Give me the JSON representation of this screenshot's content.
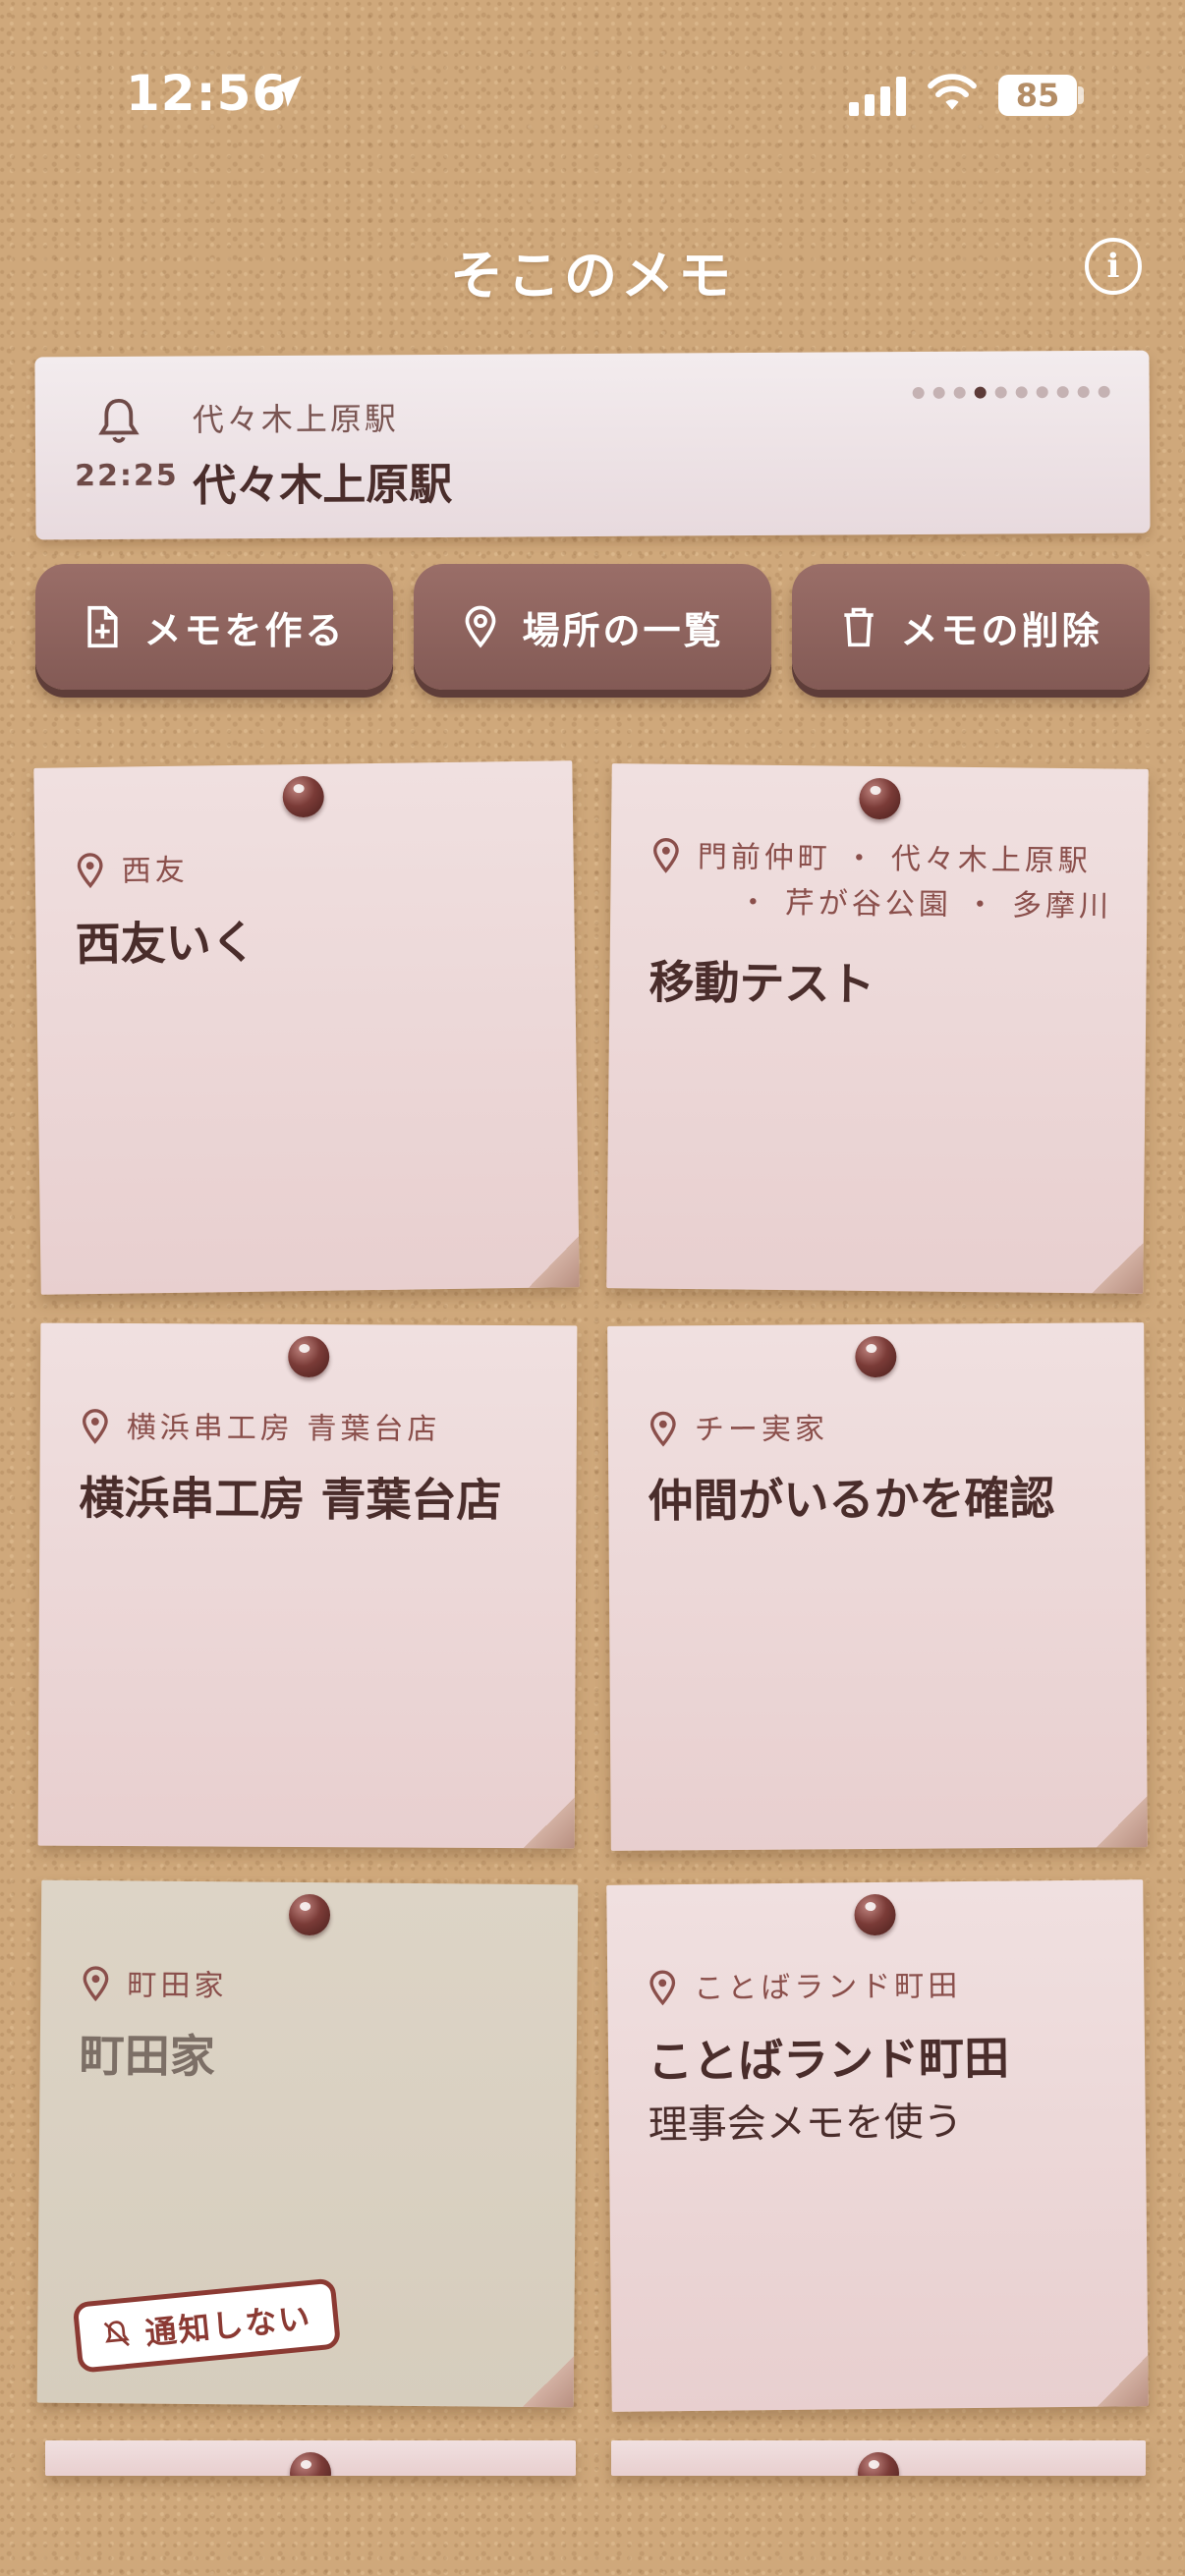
{
  "status_bar": {
    "time": "12:56",
    "battery": "85"
  },
  "header": {
    "title": "そこのメモ"
  },
  "banner": {
    "time": "22:25",
    "subtitle": "代々木上原駅",
    "title": "代々木上原駅",
    "page_count": 10,
    "active_page": 3
  },
  "actions": {
    "create_label": "メモを作る",
    "places_label": "場所の一覧",
    "delete_label": "メモの削除"
  },
  "notes": [
    {
      "location": "西友",
      "title": "西友いく",
      "body": ""
    },
    {
      "location_line1": "門前仲町 ・ 代々木上原駅",
      "location_line2": "・ 芹が谷公園 ・ 多摩川",
      "title": "移動テスト",
      "body": ""
    },
    {
      "location": "横浜串工房 青葉台店",
      "title": "横浜串工房 青葉台店",
      "body": ""
    },
    {
      "location": "チー実家",
      "title": "仲間がいるかを確認",
      "body": ""
    },
    {
      "location": "町田家",
      "title": "町田家",
      "body": "",
      "stamp": "通知しない",
      "muted": true
    },
    {
      "location": "ことばランド町田",
      "title": "ことばランド町田",
      "body": "理事会メモを使う"
    }
  ],
  "colors": {
    "cork": "#cfa87b",
    "button": "#8e635e",
    "note_pink": "#eed9d9",
    "note_gray": "#d8cfc0",
    "text_dark": "#4a2d2b",
    "accent_red": "#8b3a33"
  }
}
